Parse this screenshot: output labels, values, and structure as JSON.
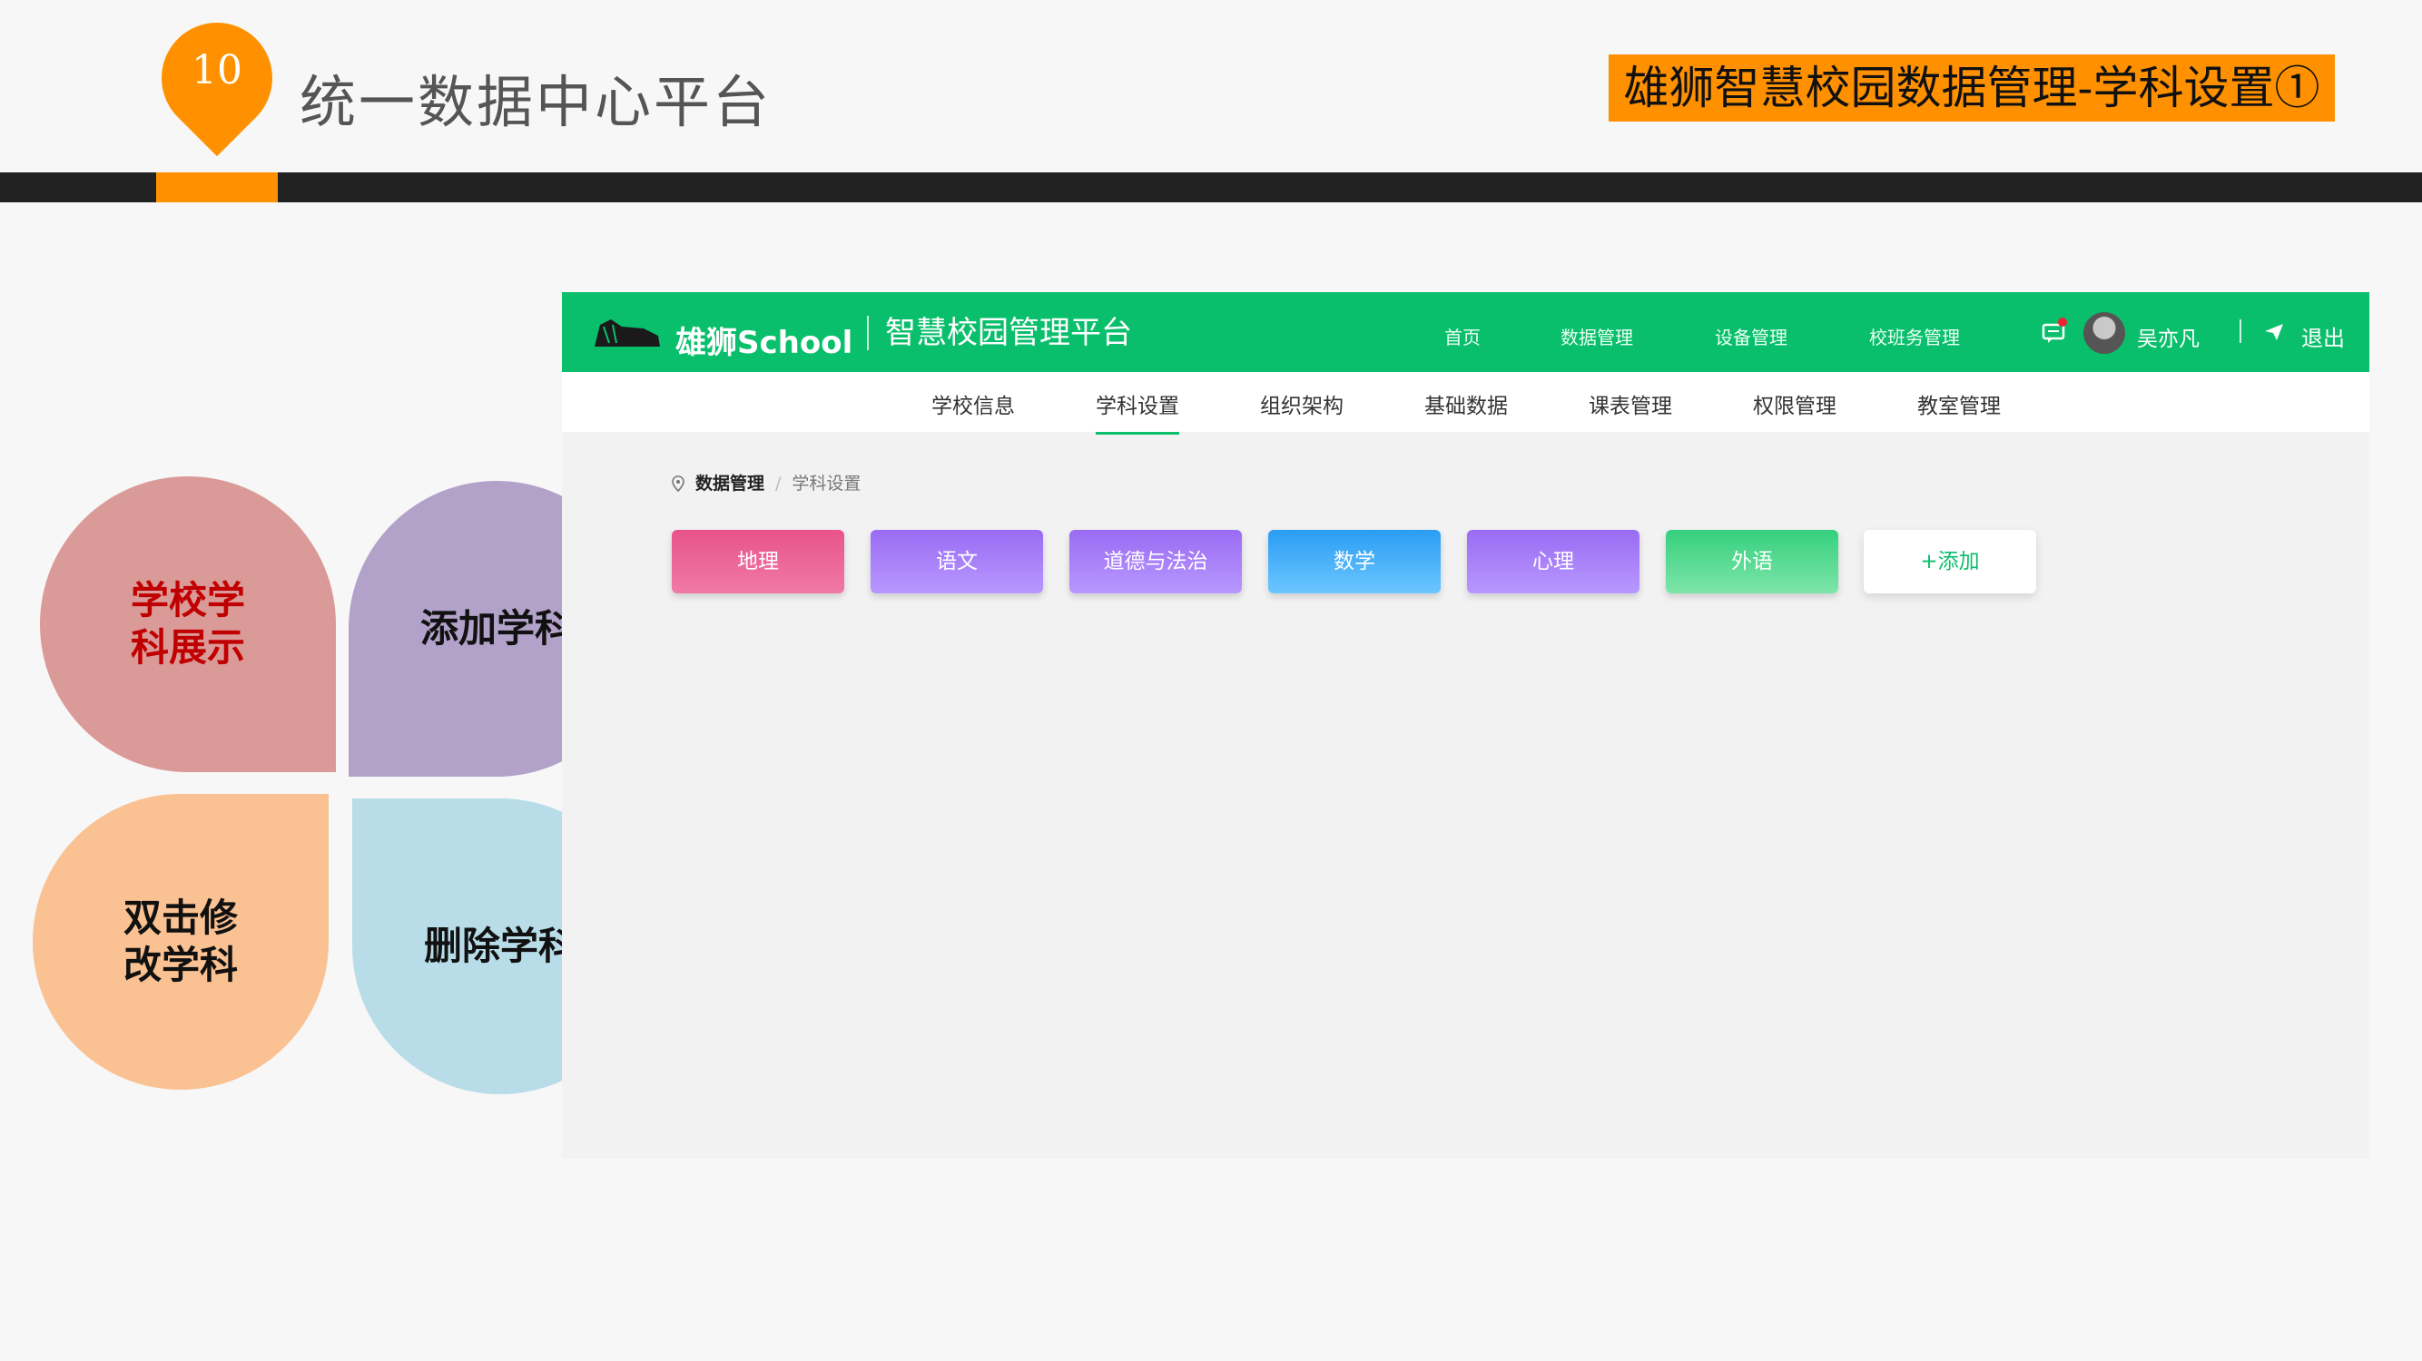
{
  "slide": {
    "number": "10",
    "title": "统一数据中心平台",
    "tag": "雄狮智慧校园数据管理-学科设置①",
    "accent_color": "#ff9100"
  },
  "petals": [
    {
      "label": "学校学科展示",
      "color": "#da9a98",
      "text_color": "#c00000"
    },
    {
      "label": "添加学科",
      "color": "#b2a1c9",
      "text_color": "#111111"
    },
    {
      "label": "双击修改学科",
      "color": "#fac192",
      "text_color": "#111111"
    },
    {
      "label": "删除学科",
      "color": "#b8dde8",
      "text_color": "#111111"
    }
  ],
  "app": {
    "brand": "雄狮School",
    "platform_title": "智慧校园管理平台",
    "theme_color": "#0abf6b",
    "header_nav": [
      "首页",
      "数据管理",
      "设备管理",
      "校班务管理"
    ],
    "user": {
      "name": "吴亦凡",
      "avatar": "avatar-photo"
    },
    "logout": "退出",
    "icons": {
      "message": "message-icon",
      "logout": "send-icon",
      "breadcrumb": "location-pin-icon"
    },
    "subnav": [
      {
        "label": "学校信息",
        "active": false
      },
      {
        "label": "学科设置",
        "active": true
      },
      {
        "label": "组织架构",
        "active": false
      },
      {
        "label": "基础数据",
        "active": false
      },
      {
        "label": "课表管理",
        "active": false
      },
      {
        "label": "权限管理",
        "active": false
      },
      {
        "label": "教室管理",
        "active": false
      }
    ],
    "breadcrumb": {
      "root": "数据管理",
      "separator": "/",
      "current": "学科设置"
    },
    "subjects": [
      {
        "label": "地理",
        "gradient": [
          "#e8538a",
          "#f07aa6"
        ]
      },
      {
        "label": "语文",
        "gradient": [
          "#9a6bf3",
          "#b898ff"
        ]
      },
      {
        "label": "道德与法治",
        "gradient": [
          "#9a6bf3",
          "#b898ff"
        ]
      },
      {
        "label": "数学",
        "gradient": [
          "#2a9df4",
          "#6cc6ff"
        ]
      },
      {
        "label": "心理",
        "gradient": [
          "#9a6bf3",
          "#b898ff"
        ]
      },
      {
        "label": "外语",
        "gradient": [
          "#35d07f",
          "#7ee5a8"
        ]
      }
    ],
    "add_label": "+添加"
  }
}
